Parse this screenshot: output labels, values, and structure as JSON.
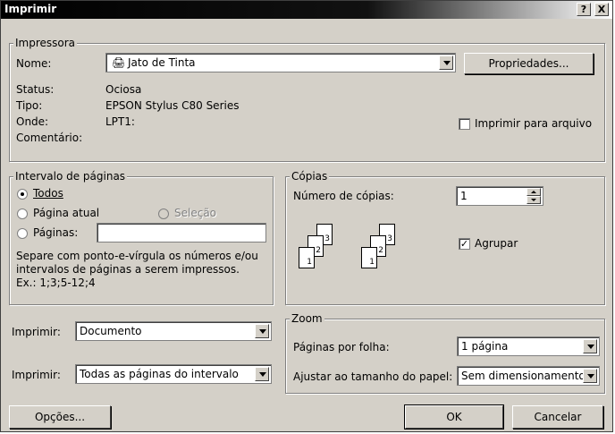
{
  "window": {
    "title": "Imprimir",
    "help_glyph": "?",
    "close_glyph": "X"
  },
  "printer": {
    "legend": "Impressora",
    "name_label": "Nome:",
    "name_value": "Jato de Tinta",
    "properties_button": "Propriedades...",
    "status_label": "Status:",
    "status_value": "Ociosa",
    "type_label": "Tipo:",
    "type_value": "EPSON Stylus C80 Series",
    "where_label": "Onde:",
    "where_value": "LPT1:",
    "comment_label": "Comentário:",
    "comment_value": "",
    "print_to_file_label": "Imprimir para arquivo",
    "print_to_file_checked": false
  },
  "page_range": {
    "legend": "Intervalo de páginas",
    "all_label": "Todos",
    "current_page_label": "Página atual",
    "selection_label": "Seleção",
    "pages_label": "Páginas:",
    "pages_value": "",
    "help_text_1": "Separe com ponto-e-vírgula os números e/ou",
    "help_text_2": "intervalos de páginas a serem impressos.",
    "help_text_3": "Ex.: 1;3;5-12;4",
    "selected": "all"
  },
  "copies": {
    "legend": "Cópias",
    "count_label": "Número de cópias:",
    "count_value": "1",
    "collate_label": "Agrupar",
    "collate_checked": true,
    "stack_labels": [
      "3",
      "2",
      "1"
    ]
  },
  "print_what": {
    "label": "Imprimir:",
    "value": "Documento"
  },
  "print": {
    "label": "Imprimir:",
    "value": "Todas as páginas do intervalo"
  },
  "zoom": {
    "legend": "Zoom",
    "pages_per_sheet_label": "Páginas por folha:",
    "pages_per_sheet_value": "1 página",
    "scale_label": "Ajustar ao tamanho do papel:",
    "scale_value": "Sem dimensionamento"
  },
  "buttons": {
    "options": "Opções...",
    "ok": "OK",
    "cancel": "Cancelar"
  }
}
